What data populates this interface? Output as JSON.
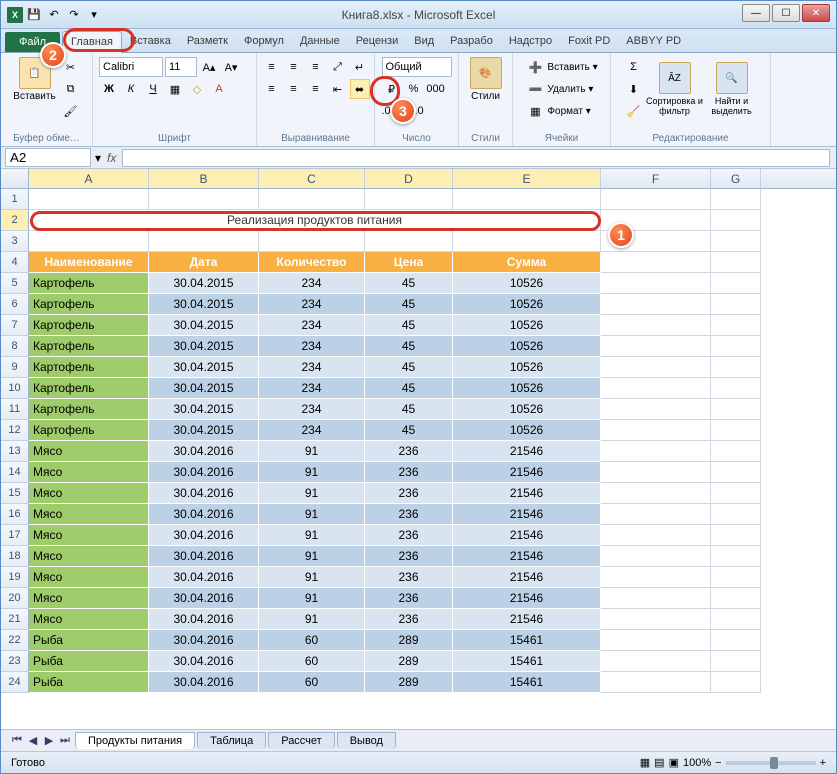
{
  "window": {
    "title": "Книга8.xlsx - Microsoft Excel"
  },
  "qat": {
    "save": "save",
    "undo": "undo",
    "redo": "redo"
  },
  "tabs": {
    "file": "Файл",
    "items": [
      "Главная",
      "Вставка",
      "Разметк",
      "Формул",
      "Данные",
      "Рецензи",
      "Вид",
      "Разрабо",
      "Надстро",
      "Foxit PD",
      "ABBYY PD"
    ],
    "active_index": 0
  },
  "ribbon": {
    "clipboard": {
      "paste": "Вставить",
      "label": "Буфер обме…"
    },
    "font": {
      "name": "Calibri",
      "size": "11",
      "label": "Шрифт"
    },
    "alignment": {
      "label": "Выравнивание"
    },
    "number": {
      "format": "Общий",
      "label": "Число"
    },
    "styles": {
      "styles": "Стили",
      "label": "Стили"
    },
    "cells": {
      "insert": "Вставить ▾",
      "delete": "Удалить ▾",
      "format": "Формат ▾",
      "label": "Ячейки"
    },
    "editing": {
      "sort": "Сортировка и фильтр",
      "find": "Найти и выделить",
      "label": "Редактирование"
    }
  },
  "namebox": {
    "ref": "A2",
    "fx": "fx"
  },
  "markers": {
    "m1": "1",
    "m2": "2",
    "m3": "3"
  },
  "grid": {
    "columns": [
      "A",
      "B",
      "C",
      "D",
      "E",
      "F",
      "G"
    ],
    "title_text": "Реализация продуктов питания",
    "headers": [
      "Наименование",
      "Дата",
      "Количество",
      "Цена",
      "Сумма"
    ],
    "rows": [
      {
        "n": "Картофель",
        "d": "30.04.2015",
        "q": "234",
        "p": "45",
        "s": "10526"
      },
      {
        "n": "Картофель",
        "d": "30.04.2015",
        "q": "234",
        "p": "45",
        "s": "10526"
      },
      {
        "n": "Картофель",
        "d": "30.04.2015",
        "q": "234",
        "p": "45",
        "s": "10526"
      },
      {
        "n": "Картофель",
        "d": "30.04.2015",
        "q": "234",
        "p": "45",
        "s": "10526"
      },
      {
        "n": "Картофель",
        "d": "30.04.2015",
        "q": "234",
        "p": "45",
        "s": "10526"
      },
      {
        "n": "Картофель",
        "d": "30.04.2015",
        "q": "234",
        "p": "45",
        "s": "10526"
      },
      {
        "n": "Картофель",
        "d": "30.04.2015",
        "q": "234",
        "p": "45",
        "s": "10526"
      },
      {
        "n": "Картофель",
        "d": "30.04.2015",
        "q": "234",
        "p": "45",
        "s": "10526"
      },
      {
        "n": "Мясо",
        "d": "30.04.2016",
        "q": "91",
        "p": "236",
        "s": "21546"
      },
      {
        "n": "Мясо",
        "d": "30.04.2016",
        "q": "91",
        "p": "236",
        "s": "21546"
      },
      {
        "n": "Мясо",
        "d": "30.04.2016",
        "q": "91",
        "p": "236",
        "s": "21546"
      },
      {
        "n": "Мясо",
        "d": "30.04.2016",
        "q": "91",
        "p": "236",
        "s": "21546"
      },
      {
        "n": "Мясо",
        "d": "30.04.2016",
        "q": "91",
        "p": "236",
        "s": "21546"
      },
      {
        "n": "Мясо",
        "d": "30.04.2016",
        "q": "91",
        "p": "236",
        "s": "21546"
      },
      {
        "n": "Мясо",
        "d": "30.04.2016",
        "q": "91",
        "p": "236",
        "s": "21546"
      },
      {
        "n": "Мясо",
        "d": "30.04.2016",
        "q": "91",
        "p": "236",
        "s": "21546"
      },
      {
        "n": "Мясо",
        "d": "30.04.2016",
        "q": "91",
        "p": "236",
        "s": "21546"
      },
      {
        "n": "Рыба",
        "d": "30.04.2016",
        "q": "60",
        "p": "289",
        "s": "15461"
      },
      {
        "n": "Рыба",
        "d": "30.04.2016",
        "q": "60",
        "p": "289",
        "s": "15461"
      },
      {
        "n": "Рыба",
        "d": "30.04.2016",
        "q": "60",
        "p": "289",
        "s": "15461"
      }
    ]
  },
  "sheet_tabs": {
    "active": "Продукты питания",
    "others": [
      "Таблица",
      "Рассчет",
      "Вывод"
    ]
  },
  "status": {
    "ready": "Готово",
    "zoom": "100%",
    "minus": "−",
    "plus": "+"
  }
}
